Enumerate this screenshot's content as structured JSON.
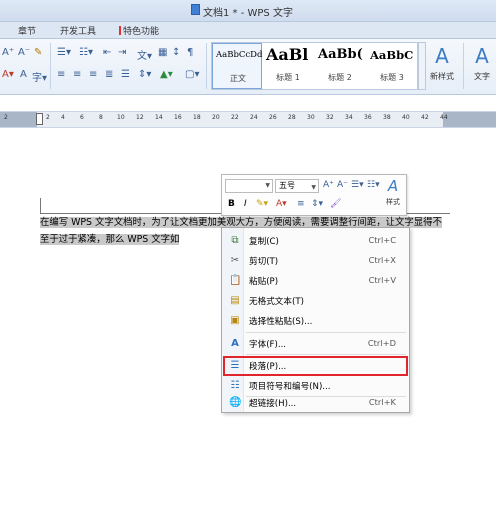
{
  "window": {
    "title": "文档1 * - WPS 文字"
  },
  "tabs": [
    {
      "label": "章节"
    },
    {
      "label": "开发工具"
    },
    {
      "label": "特色功能"
    }
  ],
  "ribbon": {
    "styles": [
      {
        "sample": "AaBbCcDd",
        "name": "正文"
      },
      {
        "sample": "AaBl",
        "name": "标题 1"
      },
      {
        "sample": "AaBb(",
        "name": "标题 2"
      },
      {
        "sample": "AaBbC",
        "name": "标题 3"
      }
    ],
    "new_style_label": "新样式",
    "text_tools_label": "文字"
  },
  "ruler": {
    "ticks": [
      "2",
      "2",
      "4",
      "6",
      "8",
      "10",
      "12",
      "14",
      "16",
      "18",
      "20",
      "22",
      "24",
      "26",
      "28",
      "30",
      "32",
      "34",
      "36",
      "38",
      "40",
      "42",
      "44"
    ]
  },
  "document": {
    "paragraph": "在编写 WPS 文字文档时，为了让文档更加美观大方，方便阅读，需要调整行间距，让文字显得不至于过于紧凑，那么 WPS 文字如"
  },
  "mini_toolbar": {
    "font_value": "",
    "size_value": "五号",
    "style_label": "样式"
  },
  "context_menu": {
    "items": [
      {
        "label": "复制(C)",
        "shortcut": "Ctrl+C",
        "icon": "copy-icon"
      },
      {
        "label": "剪切(T)",
        "shortcut": "Ctrl+X",
        "icon": "scissors-icon"
      },
      {
        "label": "粘贴(P)",
        "shortcut": "Ctrl+V",
        "icon": "paste-icon"
      },
      {
        "label": "无格式文本(T)",
        "shortcut": "",
        "icon": "paste-plain-icon"
      },
      {
        "label": "选择性粘贴(S)...",
        "shortcut": "",
        "icon": "paste-special-icon"
      },
      {
        "label": "字体(F)...",
        "shortcut": "Ctrl+D",
        "icon": "font-icon"
      },
      {
        "label": "段落(P)...",
        "shortcut": "",
        "icon": "paragraph-icon"
      },
      {
        "label": "项目符号和编号(N)...",
        "shortcut": "",
        "icon": "bullets-icon"
      },
      {
        "label": "超链接(H)...",
        "shortcut": "Ctrl+K",
        "icon": "hyperlink-icon"
      }
    ],
    "highlighted": "段落(P)...",
    "highlight_color": "#e0262c"
  }
}
